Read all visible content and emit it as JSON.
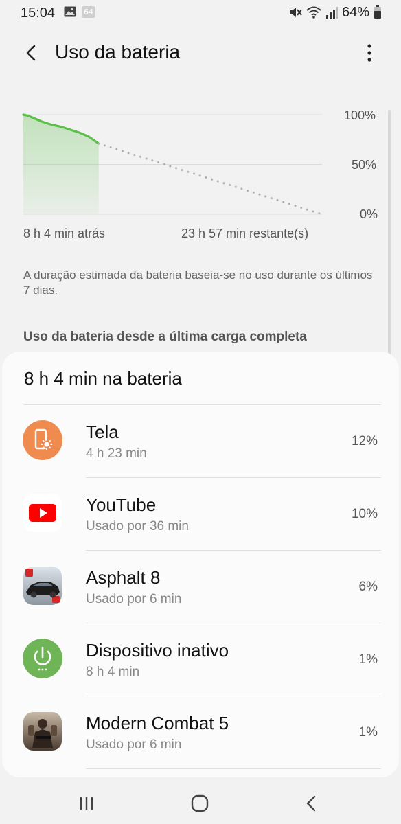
{
  "status_bar": {
    "time": "15:04",
    "badge": "64",
    "battery_percent": "64%",
    "icons": [
      "image-icon",
      "badge-icon",
      "mute-icon",
      "wifi-icon",
      "signal-icon",
      "battery-icon"
    ]
  },
  "app_bar": {
    "title": "Uso da bateria",
    "back_icon": "back-arrow-icon",
    "more_icon": "more-vert-icon"
  },
  "chart_data": {
    "type": "line",
    "y_tick_labels": [
      "100%",
      "50%",
      "0%"
    ],
    "x_left_label": "8 h 4 min atrás",
    "x_right_label": "23 h 57 min restante(s)",
    "ylim": [
      0,
      100
    ],
    "xlim": [
      0,
      32
    ],
    "series": [
      {
        "style": "solid",
        "x": [
          0,
          0.5,
          1,
          2,
          3,
          4,
          5,
          6,
          7,
          8.07
        ],
        "y": [
          100,
          99,
          97,
          93,
          90,
          88,
          85,
          82,
          78,
          71
        ]
      },
      {
        "style": "dotted",
        "x": [
          8.07,
          32
        ],
        "y": [
          71,
          0
        ]
      }
    ]
  },
  "note": "A duração estimada da bateria baseia-se no uso durante os últimos 7 dias.",
  "section_heading": "Uso da bateria desde a última carga completa",
  "usage": {
    "title": "8 h 4 min na bateria",
    "items": [
      {
        "name": "Tela",
        "sub": "4 h 23 min",
        "pct": "12%",
        "icon": "screen-brightness-icon",
        "color": "#ef8b4f"
      },
      {
        "name": "YouTube",
        "sub": "Usado por 36 min",
        "pct": "10%",
        "icon": "youtube-icon",
        "color": "#ff0000"
      },
      {
        "name": "Asphalt 8",
        "sub": "Usado por 6 min",
        "pct": "6%",
        "icon": "asphalt-8-icon",
        "color": "#1f1f1f"
      },
      {
        "name": "Dispositivo inativo",
        "sub": "8 h 4 min",
        "pct": "1%",
        "icon": "power-icon",
        "color": "#6fb557"
      },
      {
        "name": "Modern Combat 5",
        "sub": "Usado por 6 min",
        "pct": "1%",
        "icon": "modern-combat-5-icon",
        "color": "#5a4638"
      }
    ]
  },
  "nav_bar": {
    "icons": [
      "recent-apps-icon",
      "home-icon",
      "back-icon"
    ]
  },
  "colors": {
    "accent_green": "#5bbf4a",
    "card_bg": "#fbfbfb",
    "page_bg": "#f2f2f2"
  }
}
